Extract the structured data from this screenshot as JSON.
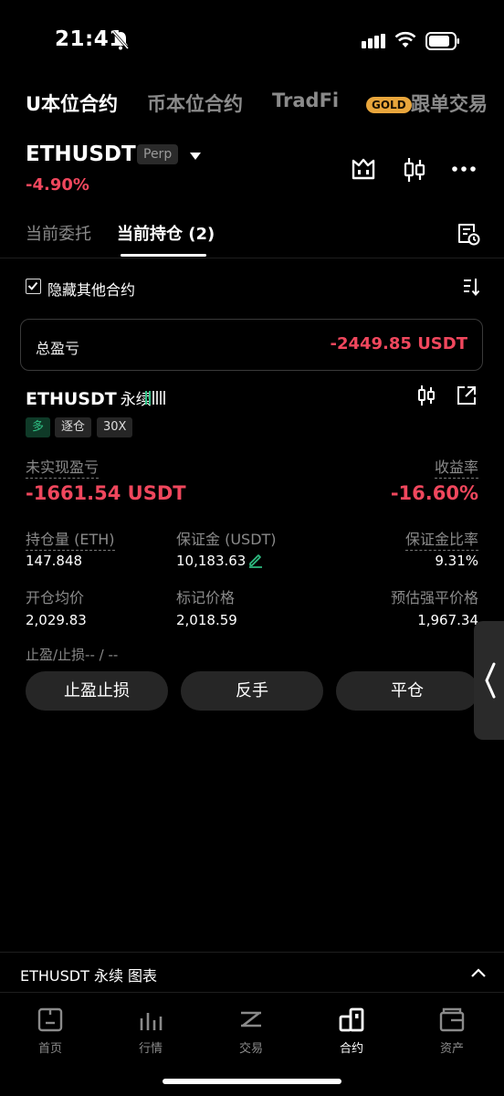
{
  "status_bar": {
    "time": "21:41"
  },
  "top_tabs": [
    {
      "label": "U本位合约",
      "active": true
    },
    {
      "label": "币本位合约",
      "active": false
    },
    {
      "label": "TradFi",
      "active": false
    },
    {
      "label": "跟单交易",
      "active": false
    }
  ],
  "gold_badge": "GOLD",
  "header": {
    "pair": "ETHUSDT",
    "badge": "Perp",
    "change": "-4.90%"
  },
  "position_tabs": [
    {
      "label": "当前委托",
      "active": false
    },
    {
      "label": "当前持仓 (2)",
      "active": true
    }
  ],
  "filter": {
    "hide_label": "隐藏其他合约",
    "checked": true
  },
  "total": {
    "label": "总盈亏",
    "value": "-2449.85 USDT"
  },
  "position": {
    "pair": "ETHUSDT",
    "contract_type": "永续",
    "tags": {
      "side": "多",
      "margin_mode": "逐仓",
      "leverage": "30X"
    },
    "unrealized_pnl_label": "未实现盈亏",
    "unrealized_pnl_value": "-1661.54 USDT",
    "roe_label": "收益率",
    "roe_value": "-16.60%",
    "size_label": "持仓量 (ETH)",
    "size_value": "147.848",
    "margin_label": "保证金 (USDT)",
    "margin_value": "10,183.63",
    "margin_ratio_label": "保证金比率",
    "margin_ratio_value": "9.31%",
    "entry_label": "开仓均价",
    "entry_value": "2,029.83",
    "mark_label": "标记价格",
    "mark_value": "2,018.59",
    "liq_label": "预估强平价格",
    "liq_value": "1,967.34",
    "tpsl_text": "止盈/止损-- / --"
  },
  "actions": {
    "tpsl": "止盈止损",
    "reverse": "反手",
    "close": "平仓"
  },
  "chart_bar": {
    "label": "ETHUSDT 永续 图表"
  },
  "bottom_nav": [
    {
      "label": "首页",
      "icon": "home-icon",
      "active": false
    },
    {
      "label": "行情",
      "icon": "markets-icon",
      "active": false
    },
    {
      "label": "交易",
      "icon": "trade-icon",
      "active": false
    },
    {
      "label": "合约",
      "icon": "futures-icon",
      "active": true
    },
    {
      "label": "资产",
      "icon": "wallet-icon",
      "active": false
    }
  ],
  "colors": {
    "negative": "#f0475d",
    "positive": "#2fbf83",
    "gold": "#e9a63c",
    "background": "#000000"
  }
}
